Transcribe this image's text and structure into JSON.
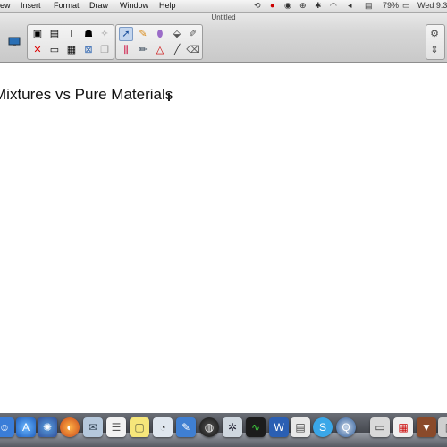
{
  "menubar": {
    "items": [
      "ew",
      "Insert",
      "Format",
      "Draw",
      "Window",
      "Help"
    ],
    "battery": "79%",
    "clock": "Wed 9:3"
  },
  "window": {
    "title": "Untitled"
  },
  "canvas": {
    "heading": "Mixtures vs Pure Materials"
  },
  "dock": {
    "icons": [
      "finder-icon",
      "app-store-icon",
      "firefox-icon",
      "mail-icon",
      "notes-icon",
      "stickies-icon",
      "preview-icon",
      "pages-icon",
      "dashboard-icon",
      "app-icon",
      "activity-monitor-icon",
      "word-icon",
      "file-icon",
      "skype-icon",
      "quicktime-icon",
      "finder-window-icon",
      "downloads-icon",
      "calendar-icon",
      "trash-icon"
    ]
  }
}
